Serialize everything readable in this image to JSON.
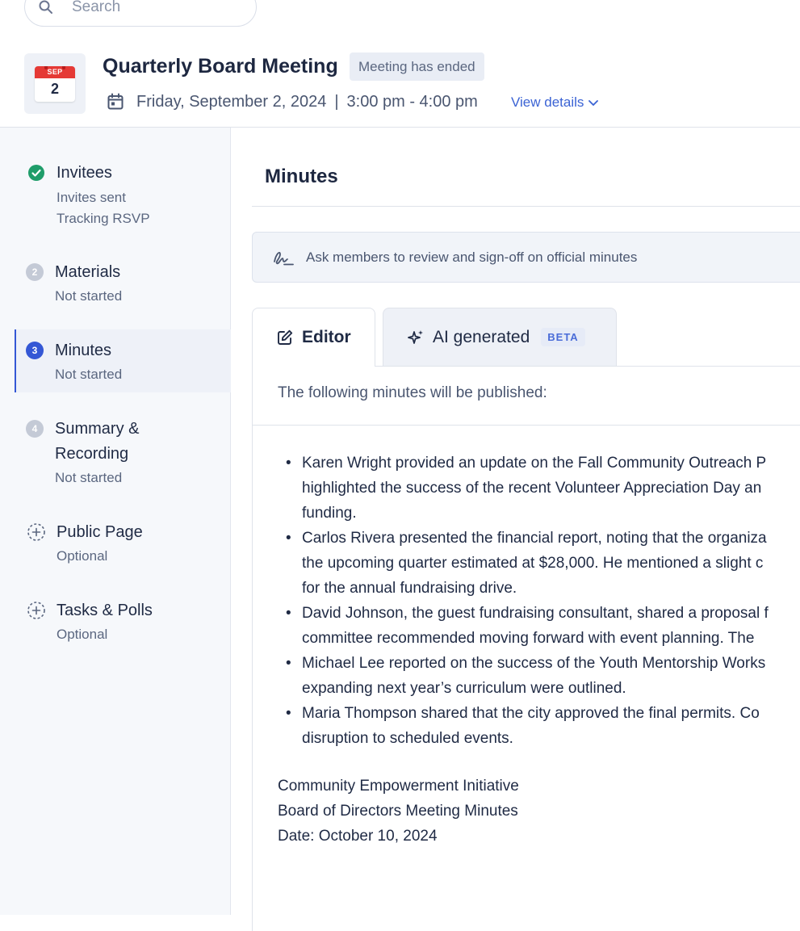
{
  "search": {
    "placeholder": "Search"
  },
  "header": {
    "calendar_month": "SEP",
    "calendar_day": "2",
    "title": "Quarterly Board Meeting",
    "status": "Meeting has ended",
    "date": "Friday, September 2, 2024",
    "separator": "|",
    "time": "3:00 pm - 4:00 pm",
    "view_details": "View details"
  },
  "sidebar": {
    "steps": [
      {
        "title": "Invitees",
        "sub": [
          "Invites sent",
          "Tracking RSVP"
        ],
        "state": "done"
      },
      {
        "number": "2",
        "title": "Materials",
        "sub": [
          "Not started"
        ],
        "state": "pending"
      },
      {
        "number": "3",
        "title": "Minutes",
        "sub": [
          "Not started"
        ],
        "state": "active"
      },
      {
        "number": "4",
        "title": [
          "Summary &",
          "Recording"
        ],
        "sub": [
          "Not started"
        ],
        "state": "pending"
      },
      {
        "title": "Public Page",
        "sub": [
          "Optional"
        ],
        "state": "optional"
      },
      {
        "title": "Tasks & Polls",
        "sub": [
          "Optional"
        ],
        "state": "optional"
      }
    ]
  },
  "main": {
    "heading": "Minutes",
    "sign_banner": "Ask members to review and sign-off on official minutes",
    "tabs": {
      "editor": "Editor",
      "ai": "AI generated",
      "beta": "BETA"
    },
    "publish_note": "The following minutes will be published:",
    "bullets": [
      [
        "Karen Wright provided an update on the Fall Community Outreach P",
        "highlighted the success of the recent Volunteer Appreciation Day an",
        "funding."
      ],
      [
        "Carlos Rivera presented the financial report, noting that the organiza",
        "the upcoming quarter estimated at $28,000. He mentioned a slight c",
        "for the annual fundraising drive."
      ],
      [
        "David Johnson, the guest fundraising consultant, shared a proposal f",
        "committee recommended moving forward with event planning. The"
      ],
      [
        "Michael Lee reported on the success of the Youth Mentorship Works",
        "expanding next year’s curriculum were outlined."
      ],
      [
        "Maria Thompson shared that the city approved the final permits. Co",
        "disruption to scheduled events."
      ]
    ],
    "footer": [
      "Community Empowerment Initiative",
      "Board of Directors Meeting Minutes",
      "Date: October 10, 2024"
    ]
  },
  "colors": {
    "accent": "#3457d5",
    "done_green": "#1f9d6a",
    "calendar_red": "#e53935"
  },
  "icons": [
    "search-icon",
    "calendar-icon",
    "chevron-down-icon",
    "check-circle-icon",
    "dashed-plus-circle-icon",
    "signature-icon",
    "edit-icon",
    "sparkle-icon"
  ]
}
